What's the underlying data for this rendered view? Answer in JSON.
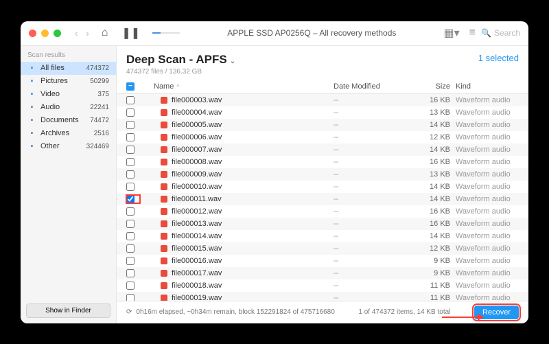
{
  "title": "APPLE SSD AP0256Q – All recovery methods",
  "search": {
    "placeholder": "Search"
  },
  "sidebar": {
    "heading": "Scan results",
    "items": [
      {
        "label": "All files",
        "count": "474372",
        "icon": "folder",
        "color": "#4a90e2"
      },
      {
        "label": "Pictures",
        "count": "50299",
        "icon": "picture",
        "color": "#4a90e2"
      },
      {
        "label": "Video",
        "count": "375",
        "icon": "video",
        "color": "#4a90e2"
      },
      {
        "label": "Audio",
        "count": "22241",
        "icon": "audio",
        "color": "#4a90e2"
      },
      {
        "label": "Documents",
        "count": "74472",
        "icon": "doc",
        "color": "#4a90e2"
      },
      {
        "label": "Archives",
        "count": "2516",
        "icon": "archive",
        "color": "#4a90e2"
      },
      {
        "label": "Other",
        "count": "324469",
        "icon": "other",
        "color": "#4a90e2"
      }
    ],
    "footer_btn": "Show in Finder"
  },
  "header": {
    "title": "Deep Scan - APFS",
    "subtitle": "474372 files / 136.32 GB",
    "selected": "1 selected"
  },
  "columns": {
    "name": "Name",
    "date": "Date Modified",
    "size": "Size",
    "kind": "Kind"
  },
  "files": [
    {
      "name": "file000003.wav",
      "date": "--",
      "size": "16 KB",
      "kind": "Waveform audio",
      "checked": false
    },
    {
      "name": "file000004.wav",
      "date": "--",
      "size": "13 KB",
      "kind": "Waveform audio",
      "checked": false
    },
    {
      "name": "file000005.wav",
      "date": "--",
      "size": "14 KB",
      "kind": "Waveform audio",
      "checked": false
    },
    {
      "name": "file000006.wav",
      "date": "--",
      "size": "12 KB",
      "kind": "Waveform audio",
      "checked": false
    },
    {
      "name": "file000007.wav",
      "date": "--",
      "size": "14 KB",
      "kind": "Waveform audio",
      "checked": false
    },
    {
      "name": "file000008.wav",
      "date": "--",
      "size": "16 KB",
      "kind": "Waveform audio",
      "checked": false
    },
    {
      "name": "file000009.wav",
      "date": "--",
      "size": "13 KB",
      "kind": "Waveform audio",
      "checked": false
    },
    {
      "name": "file000010.wav",
      "date": "--",
      "size": "14 KB",
      "kind": "Waveform audio",
      "checked": false
    },
    {
      "name": "file000011.wav",
      "date": "--",
      "size": "14 KB",
      "kind": "Waveform audio",
      "checked": true
    },
    {
      "name": "file000012.wav",
      "date": "--",
      "size": "16 KB",
      "kind": "Waveform audio",
      "checked": false
    },
    {
      "name": "file000013.wav",
      "date": "--",
      "size": "16 KB",
      "kind": "Waveform audio",
      "checked": false
    },
    {
      "name": "file000014.wav",
      "date": "--",
      "size": "14 KB",
      "kind": "Waveform audio",
      "checked": false
    },
    {
      "name": "file000015.wav",
      "date": "--",
      "size": "12 KB",
      "kind": "Waveform audio",
      "checked": false
    },
    {
      "name": "file000016.wav",
      "date": "--",
      "size": "9 KB",
      "kind": "Waveform audio",
      "checked": false
    },
    {
      "name": "file000017.wav",
      "date": "--",
      "size": "9 KB",
      "kind": "Waveform audio",
      "checked": false
    },
    {
      "name": "file000018.wav",
      "date": "--",
      "size": "11 KB",
      "kind": "Waveform audio",
      "checked": false
    },
    {
      "name": "file000019.wav",
      "date": "--",
      "size": "11 KB",
      "kind": "Waveform audio",
      "checked": false
    }
  ],
  "status": {
    "elapsed": "0h16m elapsed, ~0h34m remain, block 152291824 of 475716680",
    "total": "1 of 474372 items, 14 KB total",
    "recover": "Recover"
  }
}
